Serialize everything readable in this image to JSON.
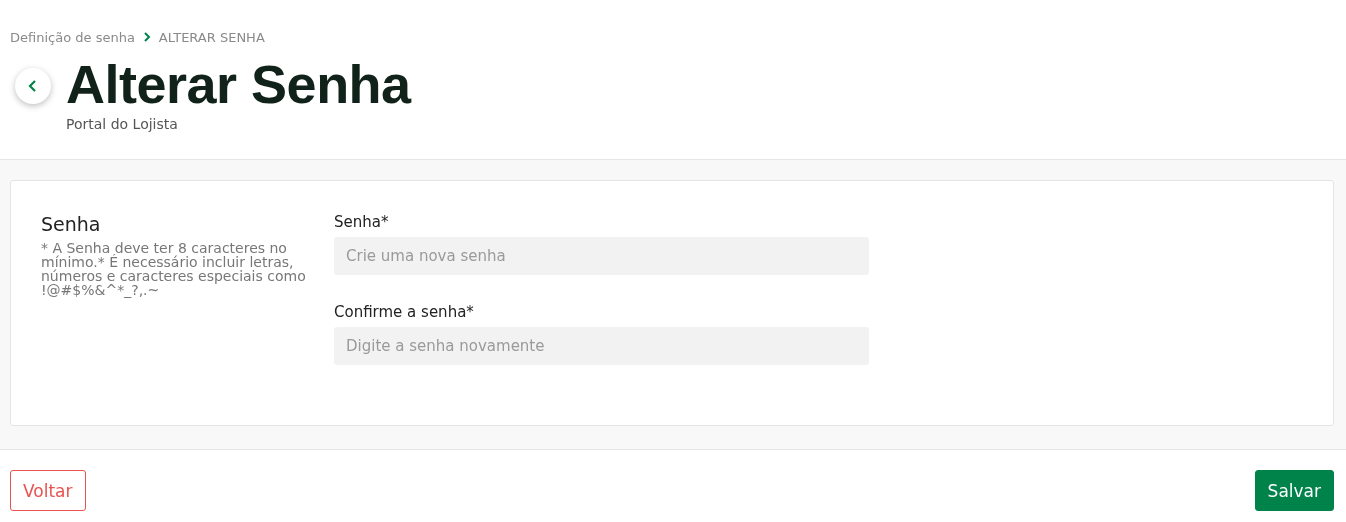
{
  "breadcrumb": [
    {
      "label": "Definição de senha"
    },
    {
      "label": "ALTERAR SENHA"
    }
  ],
  "header": {
    "title": "Alterar Senha",
    "subtitle": "Portal do Lojista"
  },
  "section": {
    "title": "Senha",
    "hint": "* A Senha deve ter 8 caracteres no mínimo.* É necessário incluir letras, números e caracteres especiais como !@#$%&^*_?,.~"
  },
  "fields": [
    {
      "label": "Senha*",
      "placeholder": "Crie uma nova senha"
    },
    {
      "label": "Confirme a senha*",
      "placeholder": "Digite a senha novamente"
    }
  ],
  "buttons": [
    {
      "label": "Voltar",
      "kind": "secondary"
    },
    {
      "label": "Salvar",
      "kind": "primary"
    }
  ]
}
